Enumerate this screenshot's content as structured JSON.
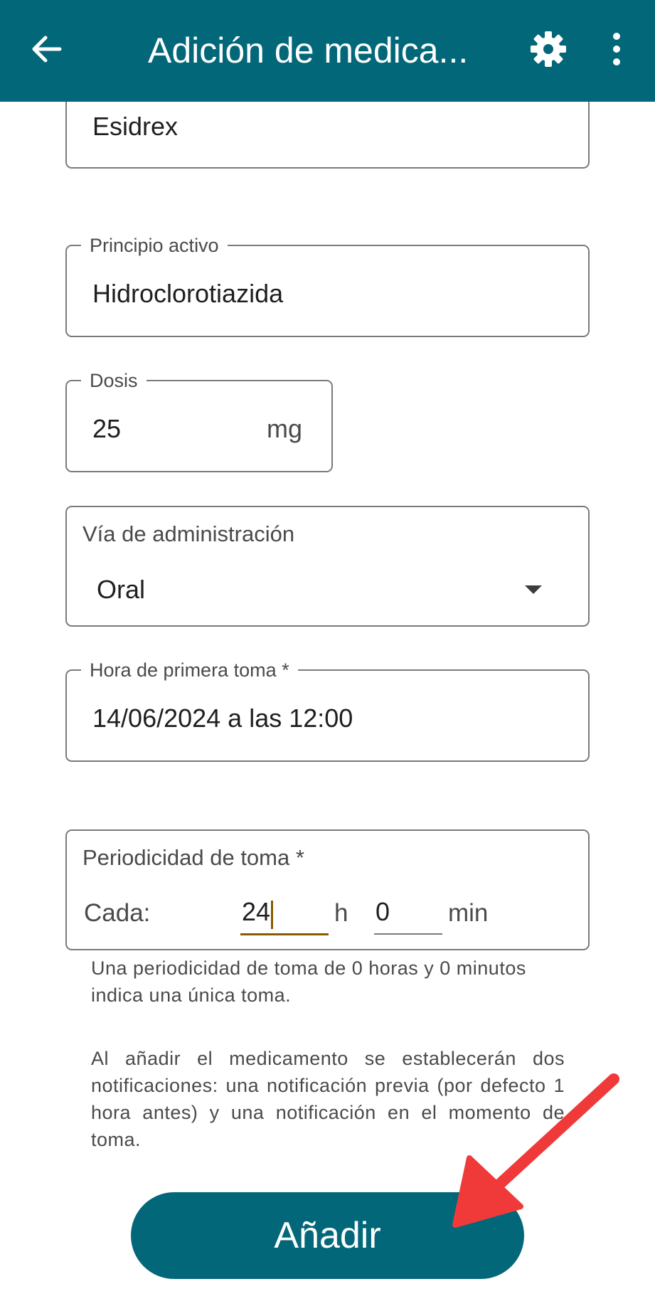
{
  "appbar": {
    "title": "Adición de medica...",
    "back_icon": "arrow-left-icon",
    "settings_icon": "gear-icon",
    "menu_icon": "more-vert-icon"
  },
  "form": {
    "name": {
      "value": "Esidrex"
    },
    "active_ingredient": {
      "label": "Principio activo",
      "value": "Hidroclorotiazida"
    },
    "dose": {
      "label": "Dosis",
      "value": "25",
      "unit": "mg"
    },
    "route": {
      "label": "Vía de administración",
      "value": "Oral"
    },
    "first_dose_time": {
      "label": "Hora de primera toma *",
      "value": "14/06/2024 a las 12:00"
    },
    "frequency": {
      "label": "Periodicidad de toma *",
      "every_label": "Cada:",
      "hours_value": "24",
      "hours_unit": "h",
      "minutes_value": "0",
      "minutes_unit": "min"
    },
    "frequency_help": "Una periodicidad de toma de 0 horas y 0 minutos indica una única toma.",
    "notifications_info": "Al añadir el medicamento se establecerán dos notificaciones: una notificación previa (por defecto 1 hora antes) y una notificación en el momento de toma."
  },
  "actions": {
    "add_label": "Añadir"
  },
  "colors": {
    "primary": "#03677a",
    "annotation_arrow": "#f03a3a",
    "focus_underline": "#8a5a00"
  }
}
